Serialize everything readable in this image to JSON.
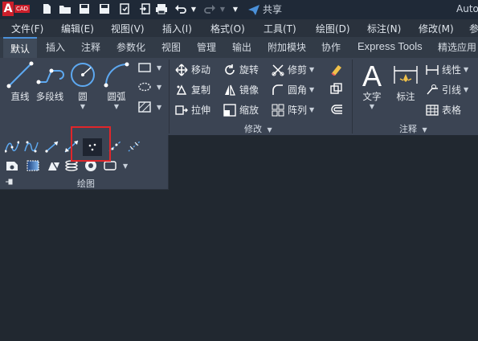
{
  "app": {
    "logo_letter": "A",
    "logo_text": "CAD",
    "title_partial": "Auto"
  },
  "quick_access": {
    "share_label": "共享"
  },
  "menubar": {
    "items": [
      "文件(F)",
      "编辑(E)",
      "视图(V)",
      "插入(I)",
      "格式(O)",
      "工具(T)",
      "绘图(D)",
      "标注(N)",
      "修改(M)",
      "参"
    ]
  },
  "ribbon_tabs": {
    "items": [
      "默认",
      "插入",
      "注释",
      "参数化",
      "视图",
      "管理",
      "输出",
      "附加模块",
      "协作",
      "Express Tools",
      "精选应用"
    ],
    "active": "默认"
  },
  "draw_panel": {
    "title": "绘图",
    "buttons": [
      "直线",
      "多段线",
      "圆",
      "圆弧"
    ]
  },
  "modify_panel": {
    "title": "修改",
    "rows": [
      [
        "移动",
        "旋转",
        "修剪"
      ],
      [
        "复制",
        "镜像",
        "圆角"
      ],
      [
        "拉伸",
        "缩放",
        "阵列"
      ]
    ]
  },
  "annotation_panel": {
    "title": "注释",
    "text_label": "文字",
    "dim_label": "标注",
    "linear_label": "线性",
    "leader_label": "引线",
    "table_label": "表格"
  },
  "colors": {
    "accent": "#4a90d9",
    "highlight_box": "#e0262a",
    "logo_red": "#cc1f2b"
  }
}
